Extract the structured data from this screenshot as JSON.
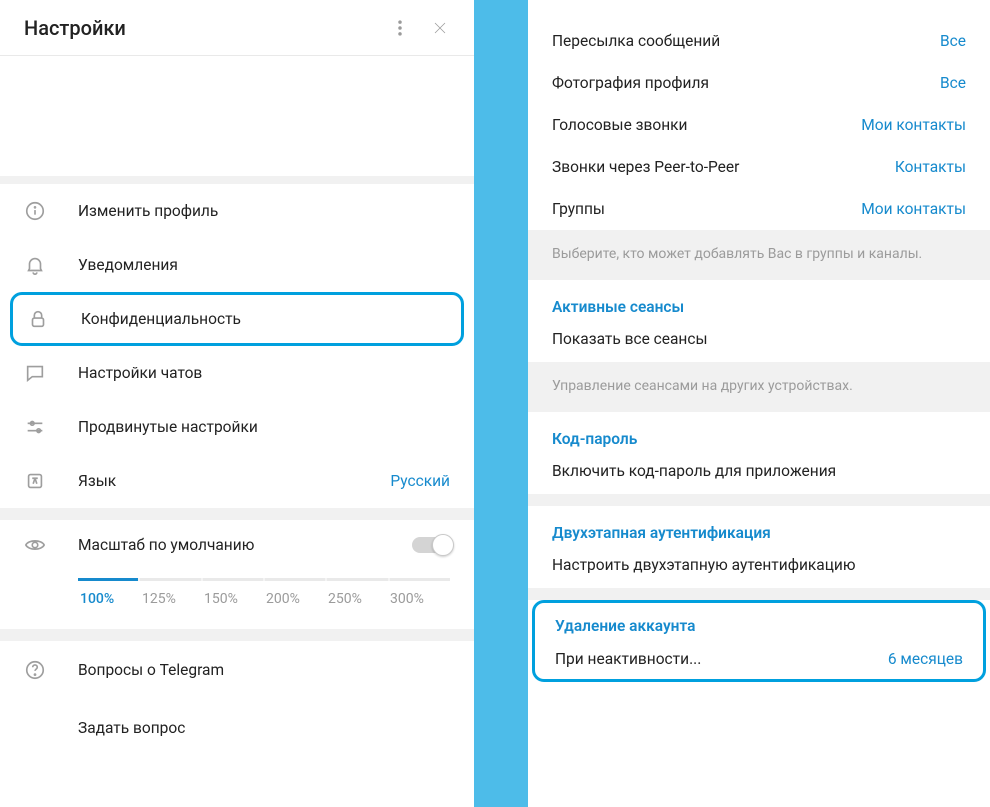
{
  "header": {
    "title": "Настройки"
  },
  "menu": {
    "edit_profile": "Изменить профиль",
    "notifications": "Уведомления",
    "privacy": "Конфиденциальность",
    "chat_settings": "Настройки чатов",
    "advanced": "Продвинутые настройки",
    "language_label": "Язык",
    "language_value": "Русский"
  },
  "scale": {
    "label": "Масштаб по умолчанию",
    "options": [
      "100%",
      "125%",
      "150%",
      "200%",
      "250%",
      "300%"
    ]
  },
  "help": {
    "faq": "Вопросы о Telegram",
    "ask": "Задать вопрос"
  },
  "privacy_rows": [
    {
      "label": "Пересылка сообщений",
      "value": "Все"
    },
    {
      "label": "Фотография профиля",
      "value": "Все"
    },
    {
      "label": "Голосовые звонки",
      "value": "Мои контакты"
    },
    {
      "label": "Звонки через Peer-to-Peer",
      "value": "Контакты"
    },
    {
      "label": "Группы",
      "value": "Мои контакты"
    }
  ],
  "hints": {
    "groups": "Выберите, кто может добавлять Вас в группы и каналы.",
    "sessions": "Управление сеансами на других устройствах."
  },
  "sections": {
    "sessions_title": "Активные сеансы",
    "sessions_item": "Показать все сеансы",
    "passcode_title": "Код-пароль",
    "passcode_item": "Включить код-пароль для приложения",
    "twostep_title": "Двухэтапная аутентификация",
    "twostep_item": "Настроить двухэтапную аутентификацию",
    "delete_title": "Удаление аккаунта",
    "delete_label": "При неактивности...",
    "delete_value": "6 месяцев"
  }
}
